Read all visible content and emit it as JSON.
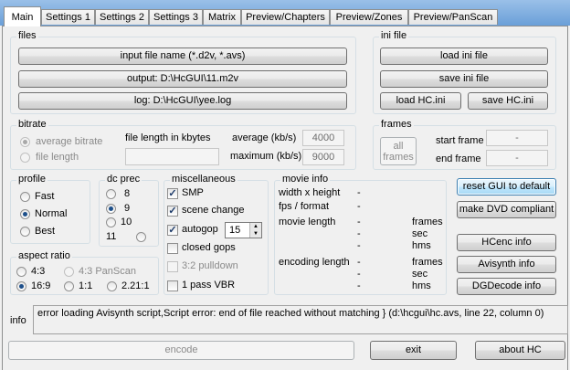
{
  "tabs": [
    "Main",
    "Settings 1",
    "Settings 2",
    "Settings 3",
    "Matrix",
    "Preview/Chapters",
    "Preview/Zones",
    "Preview/PanScan"
  ],
  "files": {
    "legend": "files",
    "input_label": "input file name (*.d2v, *.avs)",
    "output_label": "output: D:\\HcGUI\\11.m2v",
    "log_label": "log: D:\\HcGUI\\yee.log"
  },
  "ini": {
    "legend": "ini file",
    "load_ini": "load ini file",
    "save_ini": "save ini file",
    "load_hc": "load HC.ini",
    "save_hc": "save HC.ini"
  },
  "bitrate": {
    "legend": "bitrate",
    "avg_bitrate": "average bitrate",
    "file_length": "file length",
    "file_length_kb": "file length in kbytes",
    "average_label": "average (kb/s)",
    "average_value": "4000",
    "maximum_label": "maximum (kb/s)",
    "maximum_value": "9000"
  },
  "frames": {
    "legend": "frames",
    "all_frames": "all frames",
    "start_label": "start frame",
    "start_value": "-",
    "end_label": "end frame",
    "end_value": "-"
  },
  "profile": {
    "legend": "profile",
    "fast": "Fast",
    "normal": "Normal",
    "best": "Best"
  },
  "dcprec": {
    "legend": "dc prec",
    "v8": "8",
    "v9": "9",
    "v10": "10",
    "v11": "11"
  },
  "misc": {
    "legend": "miscellaneous",
    "smp": "SMP",
    "scene_change": "scene change",
    "autogop": "autogop",
    "autogop_value": "15",
    "closed_gops": "closed gops",
    "pulldown": "3:2 pulldown",
    "vbr": "1 pass VBR"
  },
  "movie": {
    "legend": "movie info",
    "width_height": "width x height",
    "fps_format": "fps / format",
    "movie_length": "movie length",
    "encoding_length": "encoding length",
    "dash": "-",
    "frames": "frames",
    "sec": "sec",
    "hms": "hms"
  },
  "aspect": {
    "legend": "aspect ratio",
    "r43": "4:3",
    "r43ps": "4:3 PanScan",
    "r169": "16:9",
    "r11": "1:1",
    "r221": "2.21:1"
  },
  "right_buttons": {
    "reset": "reset GUI to default",
    "dvd": "make DVD compliant",
    "hcenc": "HCenc info",
    "avisynth": "Avisynth info",
    "dgdecode": "DGDecode info"
  },
  "info": {
    "label": "info",
    "message": "error loading Avisynth script,Script error: end of file reached without matching } (d:\\hcgui\\hc.avs, line 22, column 0)"
  },
  "bottom": {
    "encode": "encode",
    "exit": "exit",
    "about": "about HC"
  }
}
